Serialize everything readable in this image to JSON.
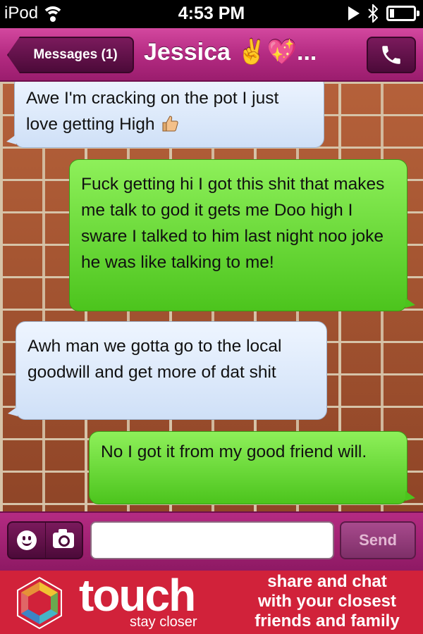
{
  "status_bar": {
    "device": "iPod",
    "time": "4:53 PM"
  },
  "nav": {
    "back_label": "Messages (1)",
    "contact_name": "Jessica ✌️💖...",
    "call_icon": "phone-icon"
  },
  "messages": [
    {
      "side": "incoming",
      "text": "Awe I'm cracking on the pot I just love getting High",
      "emoji": "thumbs-up"
    },
    {
      "side": "outgoing",
      "text": "Fuck getting hi I got this shit that makes me talk to god it gets me Doo high I sware I talked to him last night noo joke he was like talking to me!"
    },
    {
      "side": "incoming",
      "text": "Awh man we gotta go to the local goodwill and get more of dat shit"
    },
    {
      "side": "outgoing",
      "text": "No I got it from my good friend will."
    }
  ],
  "compose": {
    "emoji_icon": "smiley-icon",
    "camera_icon": "camera-icon",
    "input_value": "",
    "send_label": "Send"
  },
  "ad": {
    "brand": "touch",
    "tagline": "stay closer",
    "promo_line1": "share and chat",
    "promo_line2": "with your closest",
    "promo_line3": "friends and family"
  },
  "colors": {
    "nav_magenta": "#b42b82",
    "incoming_bubble": "#cfe0f7",
    "outgoing_bubble": "#4cc41d",
    "ad_red": "#d1223a"
  }
}
